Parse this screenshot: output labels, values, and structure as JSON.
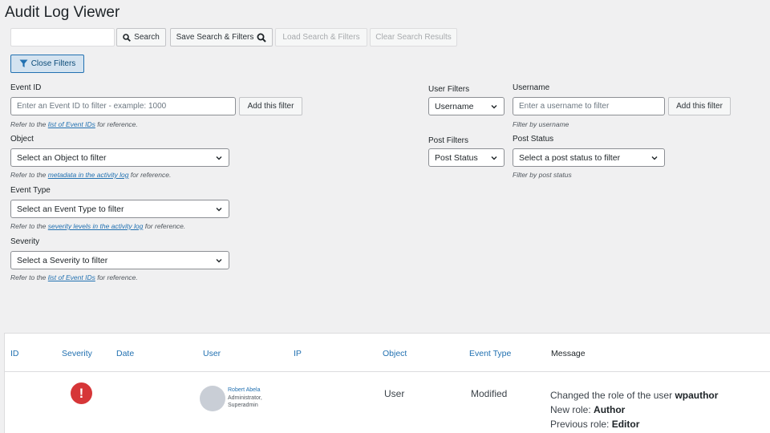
{
  "page": {
    "title": "Audit Log Viewer"
  },
  "toolbar": {
    "search_value": "",
    "search_label": "Search",
    "save_label": "Save Search & Filters",
    "load_label": "Load Search & Filters",
    "clear_label": "Clear Search Results",
    "close_filters_label": "Close Filters"
  },
  "filters": {
    "event_id": {
      "label": "Event ID",
      "placeholder": "Enter an Event ID to filter - example: 1000",
      "add_label": "Add this filter",
      "help_prefix": "Refer to the ",
      "help_link": "list of Event IDs",
      "help_suffix": " for reference."
    },
    "object": {
      "label": "Object",
      "selected": "Select an Object to filter",
      "help_prefix": "Refer to the ",
      "help_link": "metadata in the activity log",
      "help_suffix": " for reference."
    },
    "event_type": {
      "label": "Event Type",
      "selected": "Select an Event Type to filter",
      "help_prefix": "Refer to the ",
      "help_link": "severity levels in the activity log",
      "help_suffix": " for reference."
    },
    "severity": {
      "label": "Severity",
      "selected": "Select a Severity to filter",
      "help_prefix": "Refer to the ",
      "help_link": "list of Event IDs",
      "help_suffix": " for reference."
    },
    "user_filters": {
      "label": "User Filters",
      "selected": "Username",
      "field_label": "Username",
      "placeholder": "Enter a username to filter",
      "add_label": "Add this filter",
      "help": "Filter by username"
    },
    "post_filters": {
      "label": "Post Filters",
      "selected": "Post Status",
      "field_label": "Post Status",
      "field_selected": "Select a post status to filter",
      "help": "Filter by post status"
    }
  },
  "table": {
    "columns": [
      "ID",
      "Severity",
      "Date",
      "User",
      "IP",
      "Object",
      "Event Type",
      "Message"
    ],
    "rows": [
      {
        "id": "",
        "severity_icon": "!",
        "date": "",
        "user_name": "Robert Abela",
        "user_roles": "Administrator,",
        "user_roles2": "Superadmin",
        "ip": "",
        "object": "User",
        "event_type": "Modified",
        "message_line1_prefix": "Changed the role of the user ",
        "message_line1_bold": "wpauthor",
        "message_line2_prefix": "New role: ",
        "message_line2_bold": "Author",
        "message_line3_prefix": "Previous role: ",
        "message_line3_bold": "Editor"
      }
    ]
  },
  "colors": {
    "accent": "#2271b1",
    "danger": "#d63638",
    "background": "#f0f0f1"
  }
}
